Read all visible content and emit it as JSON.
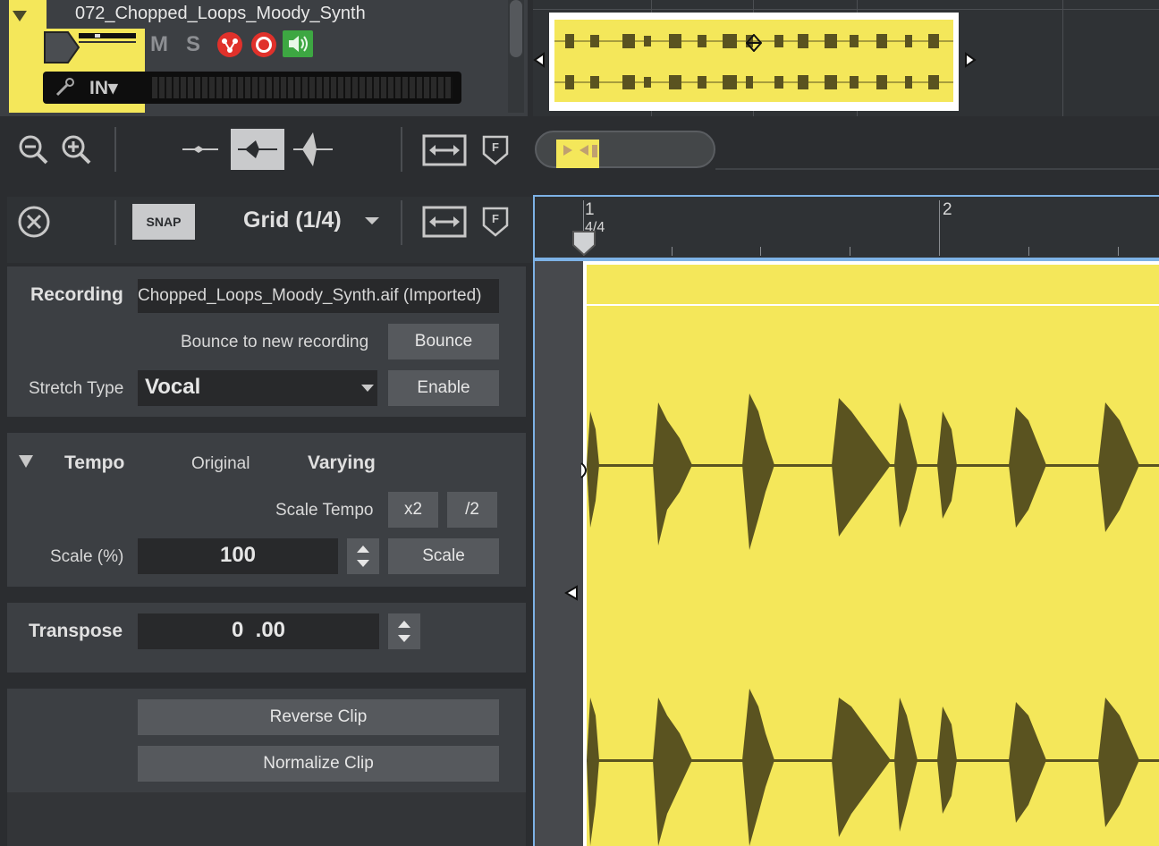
{
  "track": {
    "name": "072_Chopped_Loops_Moody_Synth",
    "mute_label": "M",
    "solo_label": "S",
    "input_label": "IN▾"
  },
  "toolbar": {
    "snap_label": "SNAP",
    "grid_label": "Grid (1/4)"
  },
  "ruler": {
    "bar1": "1",
    "bar2": "2",
    "time_sig": "4/4"
  },
  "inspector": {
    "recording_label": "Recording",
    "recording_value": "Chopped_Loops_Moody_Synth.aif (Imported)",
    "bounce_label": "Bounce to new recording",
    "bounce_button": "Bounce",
    "stretch_label": "Stretch Type",
    "stretch_value": "Vocal",
    "enable_button": "Enable",
    "tempo_label": "Tempo",
    "tempo_original": "Original",
    "tempo_varying": "Varying",
    "scale_tempo_label": "Scale Tempo",
    "x2_button": "x2",
    "half_button": "/2",
    "scale_label": "Scale (%)",
    "scale_value": "100",
    "scale_button": "Scale",
    "transpose_label": "Transpose",
    "transpose_value": "0  .00",
    "reverse_button": "Reverse Clip",
    "normalize_button": "Normalize Clip"
  },
  "colors": {
    "clip_yellow": "#f4e75a",
    "waveform": "#5a5320",
    "selection_blue": "#7db2e6",
    "record_red": "#e0312b",
    "monitor_green": "#3da742"
  }
}
